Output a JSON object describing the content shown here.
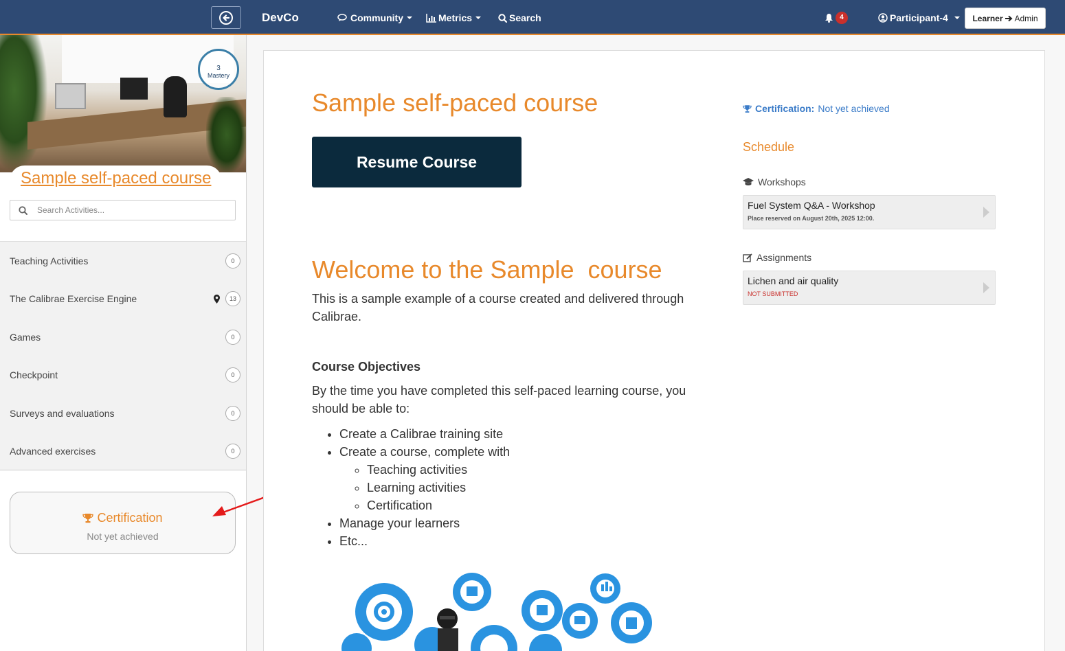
{
  "nav": {
    "brand": "DevCo",
    "items": [
      {
        "label": "Community"
      },
      {
        "label": "Metrics"
      },
      {
        "label": "Search"
      }
    ],
    "notifications_count": "4",
    "user": "Participant-4",
    "role_from": "Learner",
    "role_to": "Admin"
  },
  "sidebar": {
    "mastery_level": "3",
    "mastery_label": "Mastery",
    "course_title": "Sample self-paced course",
    "search_placeholder": "Search Activities...",
    "activities": [
      {
        "label": "Teaching Activities",
        "count": "0"
      },
      {
        "label": "The Calibrae Exercise Engine",
        "count": "13",
        "pinned": true
      },
      {
        "label": "Games",
        "count": "0"
      },
      {
        "label": "Checkpoint",
        "count": "0"
      },
      {
        "label": "Surveys and evaluations",
        "count": "0"
      },
      {
        "label": "Advanced exercises",
        "count": "0"
      }
    ],
    "certification": {
      "title": "Certification",
      "status": "Not yet achieved"
    }
  },
  "main": {
    "course_title": "Sample self-paced course",
    "resume_label": "Resume Course",
    "welcome_heading": "Welcome to the Sample  course",
    "intro": "This is a sample example of a course created and delivered through Calibrae.",
    "objectives_heading": "Course Objectives",
    "objectives_text": "By the time you have completed this self-paced learning course, you should be able to:",
    "objectives": [
      "Create a Calibrae training site",
      "Create a course, complete with",
      "Manage your learners",
      "Etc..."
    ],
    "sub_objectives": [
      "Teaching activities",
      "Learning activities",
      "Certification"
    ]
  },
  "right": {
    "cert_label": "Certification:",
    "cert_status": "Not yet achieved",
    "schedule_heading": "Schedule",
    "workshops_heading": "Workshops",
    "workshop": {
      "title": "Fuel System Q&A - Workshop",
      "subtitle": "Place reserved on August 20th, 2025 12:00."
    },
    "assignments_heading": "Assignments",
    "assignment": {
      "title": "Lichen and air quality",
      "status": "NOT SUBMITTED"
    }
  },
  "colors": {
    "nav_bg": "#2e4a74",
    "accent": "#e8892b",
    "resume_bg": "#0b2a3d",
    "link_blue": "#3a7bc8",
    "badge_red": "#c9302c"
  }
}
